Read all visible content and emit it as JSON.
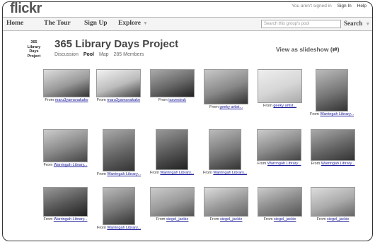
{
  "header": {
    "logo": "flickr",
    "signed_status": "You aren't signed in",
    "sign_in": "Sign In",
    "help": "Help"
  },
  "nav": {
    "home": "Home",
    "tour": "The Tour",
    "signup": "Sign Up",
    "explore": "Explore",
    "search_placeholder": "Search this group's pool",
    "search_button": "Search"
  },
  "group": {
    "icon_text": "365 Library Days Project",
    "title": "365 Library Days Project",
    "tabs": [
      "Discussion",
      "Pool",
      "Map",
      "285 Members"
    ],
    "slideshow": "View as slideshow (⇄)"
  },
  "photos": [
    {
      "author": "maru3yamanakako",
      "colors": [
        "#ddd",
        "#999",
        "#333"
      ]
    },
    {
      "author": "maru3yamanakako",
      "colors": [
        "#f2f2f2",
        "#bbb",
        "#444"
      ]
    },
    {
      "author": "isavestruk",
      "colors": [
        "#aaa",
        "#666",
        "#222"
      ]
    },
    {
      "author": "geeky artist...",
      "colors": [
        "#c8c8c8",
        "#888",
        "#333"
      ]
    },
    {
      "author": "geeky artist...",
      "colors": [
        "#eeeeee",
        "#d6d6d6",
        "#aaa"
      ]
    },
    {
      "author": "Warringah Library...",
      "colors": [
        "#bbb",
        "#777",
        "#333"
      ]
    },
    {
      "author": "Warringah Library...",
      "colors": [
        "#ccc",
        "#888",
        "#444"
      ]
    },
    {
      "author": "Warringah Library...",
      "colors": [
        "#aaa",
        "#666",
        "#333"
      ]
    },
    {
      "author": "Warringah Library...",
      "colors": [
        "#999",
        "#555",
        "#222"
      ]
    },
    {
      "author": "Warringah Library...",
      "colors": [
        "#bbb",
        "#777",
        "#333"
      ]
    },
    {
      "author": "Warringah Library...",
      "colors": [
        "#ccc",
        "#888",
        "#444"
      ]
    },
    {
      "author": "Warringah Library...",
      "colors": [
        "#aaa",
        "#666",
        "#333"
      ]
    },
    {
      "author": "Warringah Library...",
      "colors": [
        "#999",
        "#555",
        "#222"
      ]
    },
    {
      "author": "Warringah Library...",
      "colors": [
        "#bbb",
        "#777",
        "#333"
      ]
    },
    {
      "author": "siegel_jackie",
      "colors": [
        "#ccc",
        "#999",
        "#555"
      ]
    },
    {
      "author": "siegel_jackie",
      "colors": [
        "#ddd",
        "#999",
        "#666"
      ]
    },
    {
      "author": "siegel_jackie",
      "colors": [
        "#ccc",
        "#888",
        "#555"
      ]
    },
    {
      "author": "siegel_jackie",
      "colors": [
        "#ddd",
        "#aaa",
        "#666"
      ]
    }
  ],
  "from_label": "From"
}
